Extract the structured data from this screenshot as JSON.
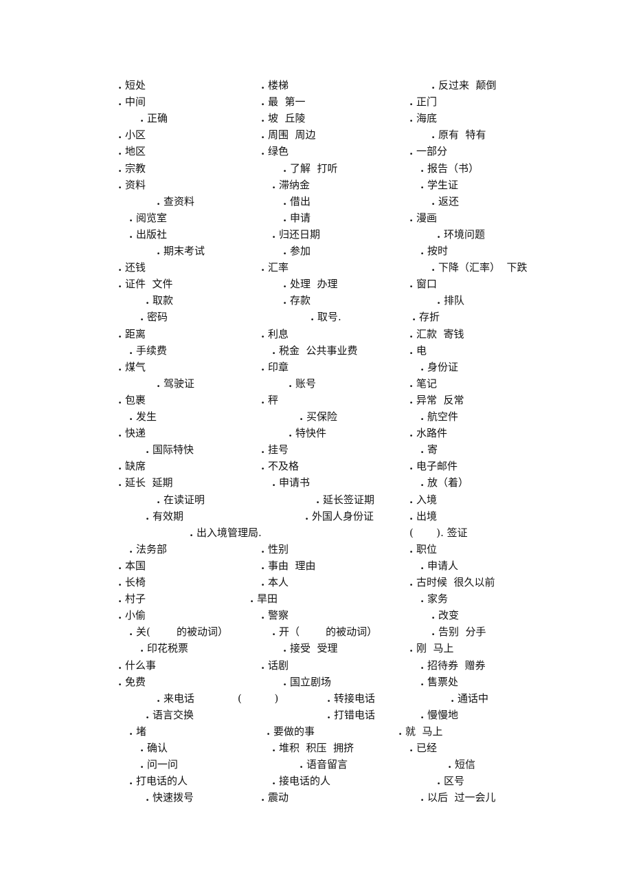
{
  "document": {
    "type": "vocabulary-list",
    "rows": [
      [
        "短处",
        "楼梯",
        "反过来  颠倒"
      ],
      [
        "中间",
        "最  第一",
        "正门"
      ],
      [
        "正确",
        "坡  丘陵",
        "海底"
      ],
      [
        "小区",
        "周围  周边",
        "原有  特有"
      ],
      [
        "地区",
        "绿色",
        "一部分"
      ],
      [
        "宗教",
        "了解  打听",
        "报告（书）"
      ],
      [
        "资料",
        "滞纳金",
        "学生证"
      ],
      [
        "查资料",
        "借出",
        "返还"
      ],
      [
        "阅览室",
        "申请",
        "漫画"
      ],
      [
        "出版社",
        "归还日期",
        "环境问题"
      ],
      [
        "期末考试",
        "参加",
        "按时"
      ],
      [
        "还钱",
        "汇率",
        "下降（汇率）  下跌"
      ],
      [
        "证件  文件",
        "处理  办理",
        "窗口"
      ],
      [
        "取款",
        "存款",
        "排队"
      ],
      [
        "密码",
        "取号.",
        "存折"
      ],
      [
        "距离",
        "利息",
        "汇款  寄钱"
      ],
      [
        "手续费",
        "税金  公共事业费",
        "电"
      ],
      [
        "煤气",
        "印章",
        "身份证"
      ],
      [
        "驾驶证",
        "账号",
        "笔记"
      ],
      [
        "包裹",
        "秤",
        "异常  反常"
      ],
      [
        "发生",
        "买保险",
        "航空件"
      ],
      [
        "快递",
        "特快件",
        "水路件"
      ],
      [
        "国际特快",
        "挂号",
        "寄"
      ],
      [
        "缺席",
        "不及格",
        "电子邮件"
      ],
      [
        "延长  延期",
        "申请书",
        "放（着）"
      ],
      [
        "在读证明",
        "延长签证期",
        "入境"
      ],
      [
        "有效期",
        "外国人身份证",
        "出境"
      ],
      [
        "出入境管理局.",
        "",
        "(       ). 签证"
      ],
      [
        "法务部",
        "性别",
        "职位"
      ],
      [
        "本国",
        "事由  理由",
        "申请人"
      ],
      [
        "长椅",
        "本人",
        "古时候  很久以前"
      ],
      [
        "村子",
        "旱田",
        "家务"
      ],
      [
        "小偷",
        "警察",
        "改变"
      ],
      [
        "关(        的被动词）",
        "开（        的被动词）",
        "告别  分手"
      ],
      [
        "印花税票",
        "接受  受理",
        "刚  马上"
      ],
      [
        "什么事",
        "话剧",
        "招待券  赠券"
      ],
      [
        "免费",
        "国立剧场",
        "售票处"
      ],
      [
        "来电话",
        "(          )",
        "转接电话",
        "通话中"
      ],
      [
        "语言交换",
        "打错电话",
        "慢慢地"
      ],
      [
        "堵",
        "要做的事",
        "就  马上"
      ],
      [
        "确认",
        "堆积  积压  拥挤",
        "已经"
      ],
      [
        "问一问",
        "语音留言",
        "短信"
      ],
      [
        "打电话的人",
        "接电话的人",
        "区号"
      ],
      [
        "快速拨号",
        "震动",
        "以后  过一会儿"
      ]
    ]
  }
}
